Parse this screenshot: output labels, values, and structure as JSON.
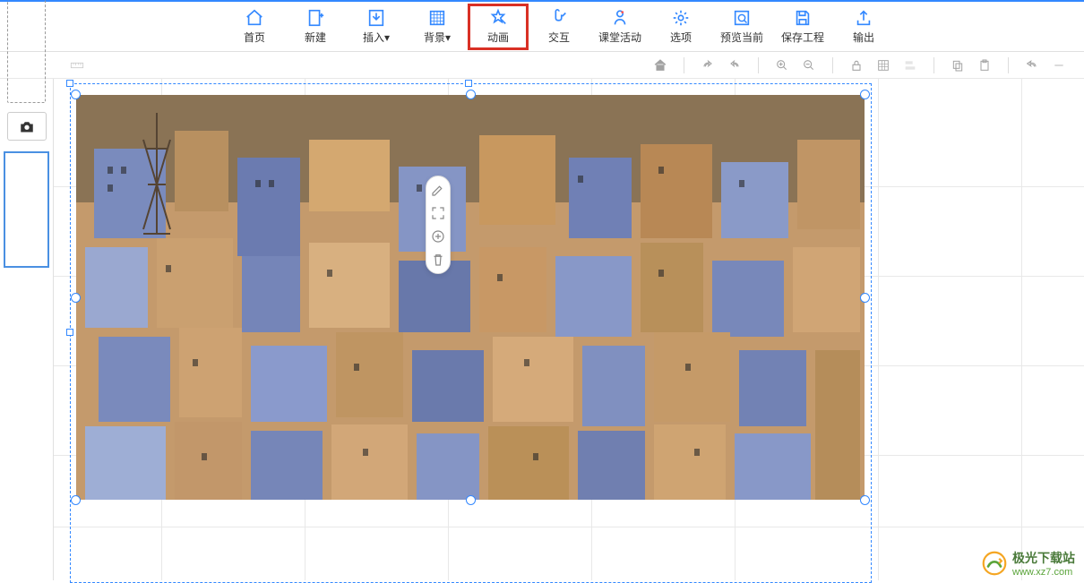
{
  "toolbar": {
    "items": [
      {
        "label": "首页",
        "icon": "home"
      },
      {
        "label": "新建",
        "icon": "new"
      },
      {
        "label": "插入",
        "icon": "insert",
        "dropdown": true
      },
      {
        "label": "背景",
        "icon": "background",
        "dropdown": true
      },
      {
        "label": "动画",
        "icon": "animation",
        "highlighted": true
      },
      {
        "label": "交互",
        "icon": "interact"
      },
      {
        "label": "课堂活动",
        "icon": "classroom"
      },
      {
        "label": "选项",
        "icon": "options"
      },
      {
        "label": "预览当前",
        "icon": "preview"
      },
      {
        "label": "保存工程",
        "icon": "save"
      },
      {
        "label": "输出",
        "icon": "export"
      }
    ]
  },
  "secondary_icons": [
    "home",
    "undo",
    "redo",
    "zoom-in",
    "zoom-out",
    "lock",
    "grid",
    "ruler",
    "copy",
    "paste",
    "back",
    "minus"
  ],
  "float_tools": [
    "edit",
    "fullscreen",
    "zoom",
    "delete"
  ],
  "watermark": {
    "title": "极光下载站",
    "url": "www.xz7.com"
  }
}
